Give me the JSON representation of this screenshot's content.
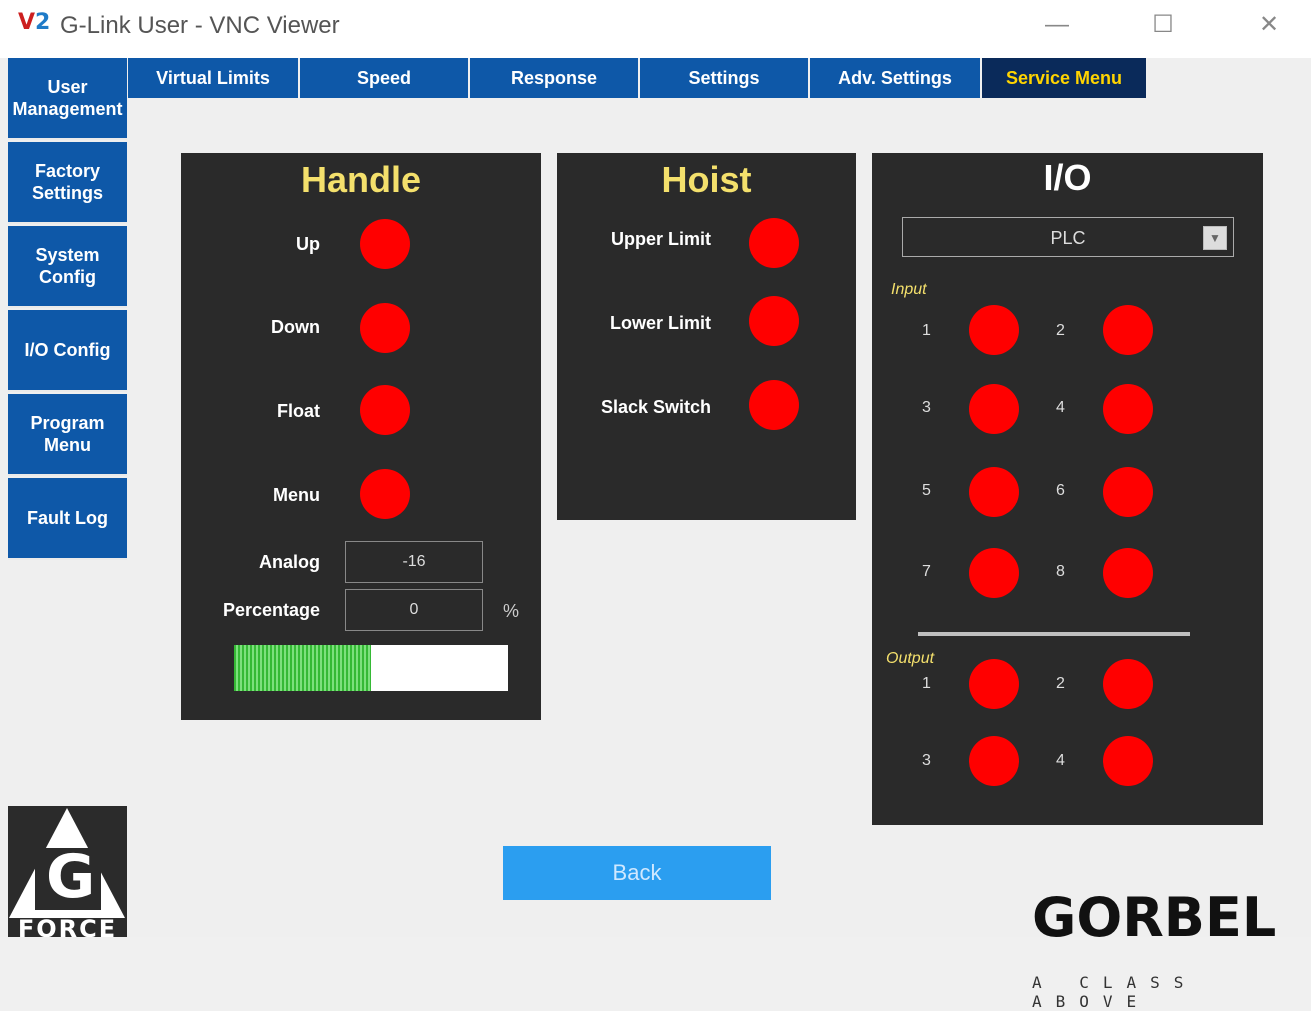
{
  "window": {
    "title": "G-Link User - VNC Viewer",
    "logo_v": "V",
    "logo_2": "2",
    "minimize": "—",
    "maximize": "☐",
    "close": "✕"
  },
  "sidebar": {
    "items": [
      {
        "label": "User Management"
      },
      {
        "label": "Factory Settings"
      },
      {
        "label": "System Config"
      },
      {
        "label": "I/O Config"
      },
      {
        "label": "Program Menu"
      },
      {
        "label": "Fault Log"
      }
    ]
  },
  "tabs": [
    {
      "label": "Virtual Limits"
    },
    {
      "label": "Speed"
    },
    {
      "label": "Response"
    },
    {
      "label": "Settings"
    },
    {
      "label": "Adv. Settings"
    },
    {
      "label": "Service Menu",
      "active": true
    }
  ],
  "handle": {
    "title": "Handle",
    "indicators": [
      {
        "label": "Up",
        "state": "off"
      },
      {
        "label": "Down",
        "state": "off"
      },
      {
        "label": "Float",
        "state": "off"
      },
      {
        "label": "Menu",
        "state": "off"
      }
    ],
    "analog_label": "Analog",
    "analog_value": "-16",
    "percentage_label": "Percentage",
    "percentage_value": "0",
    "percentage_unit": "%",
    "bar_fill_fraction": 0.5
  },
  "hoist": {
    "title": "Hoist",
    "indicators": [
      {
        "label": "Upper Limit",
        "state": "off"
      },
      {
        "label": "Lower Limit",
        "state": "off"
      },
      {
        "label": "Slack Switch",
        "state": "off"
      }
    ]
  },
  "io": {
    "title": "I/O",
    "selector_value": "PLC",
    "selector_arrow": "▼",
    "input_label": "Input",
    "inputs": [
      "1",
      "2",
      "3",
      "4",
      "5",
      "6",
      "7",
      "8"
    ],
    "output_label": "Output",
    "outputs": [
      "1",
      "2",
      "3",
      "4"
    ]
  },
  "actions": {
    "back_label": "Back"
  },
  "branding": {
    "gforce_word": "FORCE",
    "gforce_letter": "G",
    "gorbel_word": "GORBEL",
    "gorbel_tagline": "A CLASS ABOVE"
  },
  "colors": {
    "nav_blue": "#0e58a8",
    "active_tab": "#0a2a5a",
    "panel_bg": "#2a2a2a",
    "title_yellow": "#f4e06c",
    "led_off": "#ff0000",
    "back_button": "#2b9ef0"
  }
}
